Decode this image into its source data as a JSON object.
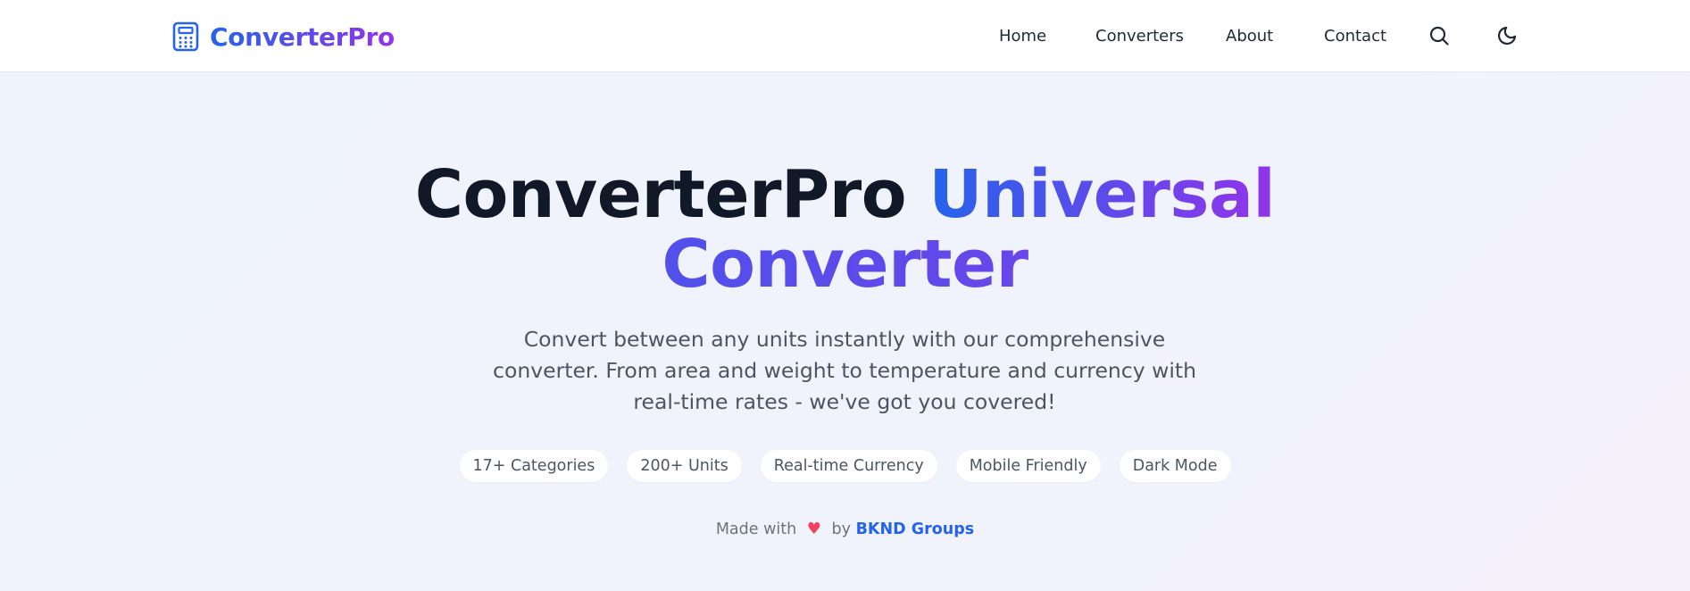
{
  "nav": {
    "brand": "ConverterPro",
    "links": [
      "Home",
      "Converters",
      "About",
      "Contact"
    ],
    "icons": [
      "calculator-icon",
      "search-icon",
      "moon-icon"
    ]
  },
  "hero": {
    "title_plain": "ConverterPro",
    "title_gradient_1": "Universal",
    "title_gradient_2": "Converter",
    "subtitle": "Convert between any units instantly with our comprehensive converter. From area and weight to temperature and currency with real-time rates - we've got you covered!",
    "badges": [
      "17+ Categories",
      "200+ Units",
      "Real-time Currency",
      "Mobile Friendly",
      "Dark Mode"
    ],
    "credit_prefix": "Made with",
    "credit_heart": "♥",
    "credit_by": "by",
    "credit_link": "BKND Groups"
  },
  "colors": {
    "gradient_start": "#2563eb",
    "gradient_end": "#9333ea",
    "heart": "#f43f5e",
    "link": "#2563eb"
  }
}
